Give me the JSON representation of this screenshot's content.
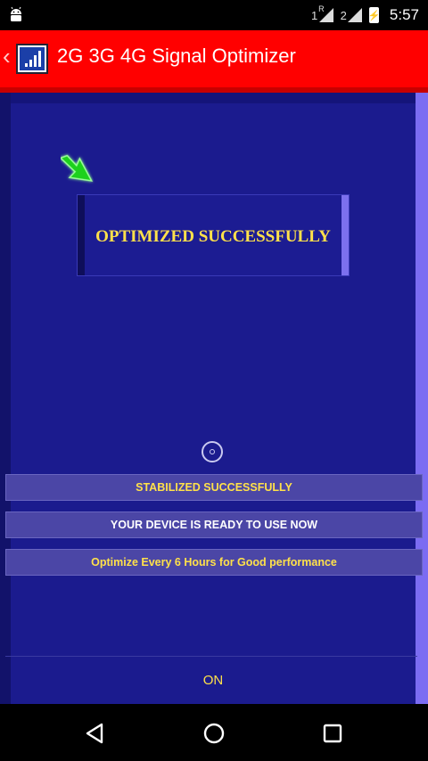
{
  "status_bar": {
    "sim1_label": "1",
    "sim1_roaming": "R",
    "sim2_label": "2",
    "battery_glyph": "⚡",
    "time": "5:57",
    "icons": [
      "android-icon",
      "signal-icon",
      "battery-icon"
    ]
  },
  "app_bar": {
    "back_glyph": "‹",
    "title": "2G 3G 4G Signal Optimizer",
    "accent_color": "#ff0000"
  },
  "main": {
    "result_text": "OPTIMIZED SUCCESSFULLY",
    "status_items": [
      "STABILIZED SUCCESSFULLY",
      "YOUR DEVICE IS READY TO USE NOW",
      "Optimize Every 6 Hours for Good performance"
    ],
    "toggle_label": "ON",
    "background_color": "#1b1b8e",
    "highlight_color": "#ffe14a"
  },
  "nav_bar": {
    "items": [
      "back-icon",
      "home-icon",
      "recents-icon"
    ]
  }
}
